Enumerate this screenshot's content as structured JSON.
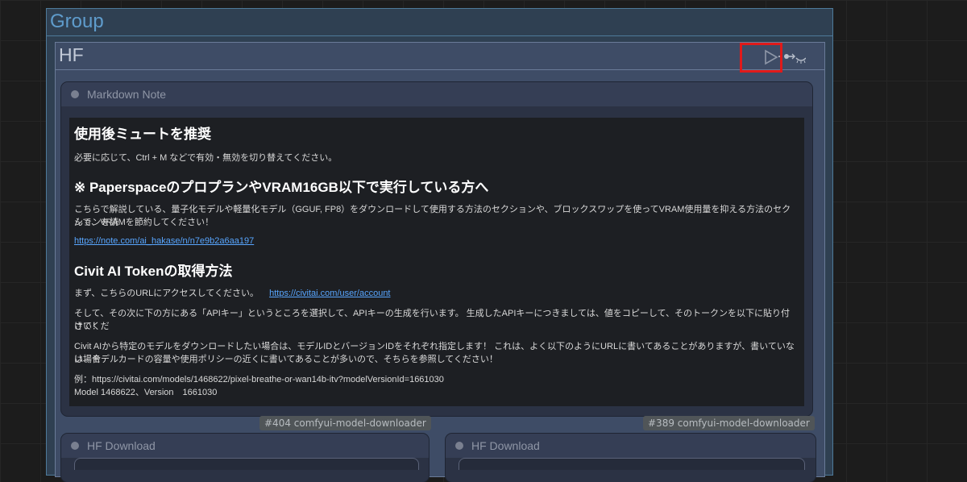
{
  "group": {
    "title": "Group"
  },
  "subgroup": {
    "title": "HF"
  },
  "markdown_node": {
    "title": "Markdown Note",
    "heading1": "使用後ミュートを推奨",
    "p1": "必要に応じて、Ctrl + M などで有効・無効を切り替えてください。",
    "heading2": "※ PaperspaceのプロプランやVRAM16GB以下で実行している方へ",
    "p2_line1": "こちらで解説している、量子化モデルや軽量化モデル（GGUF, FP8）をダウンロードして使用する方法のセクションや、ブロックスワップを使ってVRAM使用量を抑える方法のセクションを読",
    "p2_line2": "んで、VRAMを節約してください！",
    "link1": "https://note.com/ai_hakase/n/n7e9b2a6aa197",
    "heading3": "Civit AI Tokenの取得方法",
    "p3_text": "まず、こちらのURLにアクセスしてください。",
    "link2": "https://civitai.com/user/account",
    "p4_line1": "そして、その次に下の方にある「APIキー」というところを選択して、APIキーの生成を行います。 生成したAPIキーにつきましては、値をコピーして、そのトークンを以下に貼り付けてくだ",
    "p4_line2": "さい！",
    "p5_line1": "Civit AIから特定のモデルをダウンロードしたい場合は、モデルIDとバージョンIDをそれぞれ指定します！ これは、よく以下のようにURLに書いてあることがありますが、書いていない場合",
    "p5_line2": "は、モデルカードの容量や使用ポリシーの近くに書いてあることが多いので、そちらを参照してください！",
    "p6_line1": "例：https://civitai.com/models/1468622/pixel-breathe-or-wan14b-itv?modelVersionId=1661030",
    "p6_line2": "Model 1468622、Version　1661030"
  },
  "badges": [
    "#404 comfyui-model-downloader",
    "#389 comfyui-model-downloader"
  ],
  "hf_nodes": [
    {
      "title": "HF Download"
    },
    {
      "title": "HF Download"
    }
  ],
  "controls": {
    "play_icon": "play-icon",
    "bypass_icon": "bypass-icon"
  },
  "colors": {
    "highlight": "#e01a1a",
    "link": "#58a6ff",
    "group_title": "#5f9ccc"
  }
}
